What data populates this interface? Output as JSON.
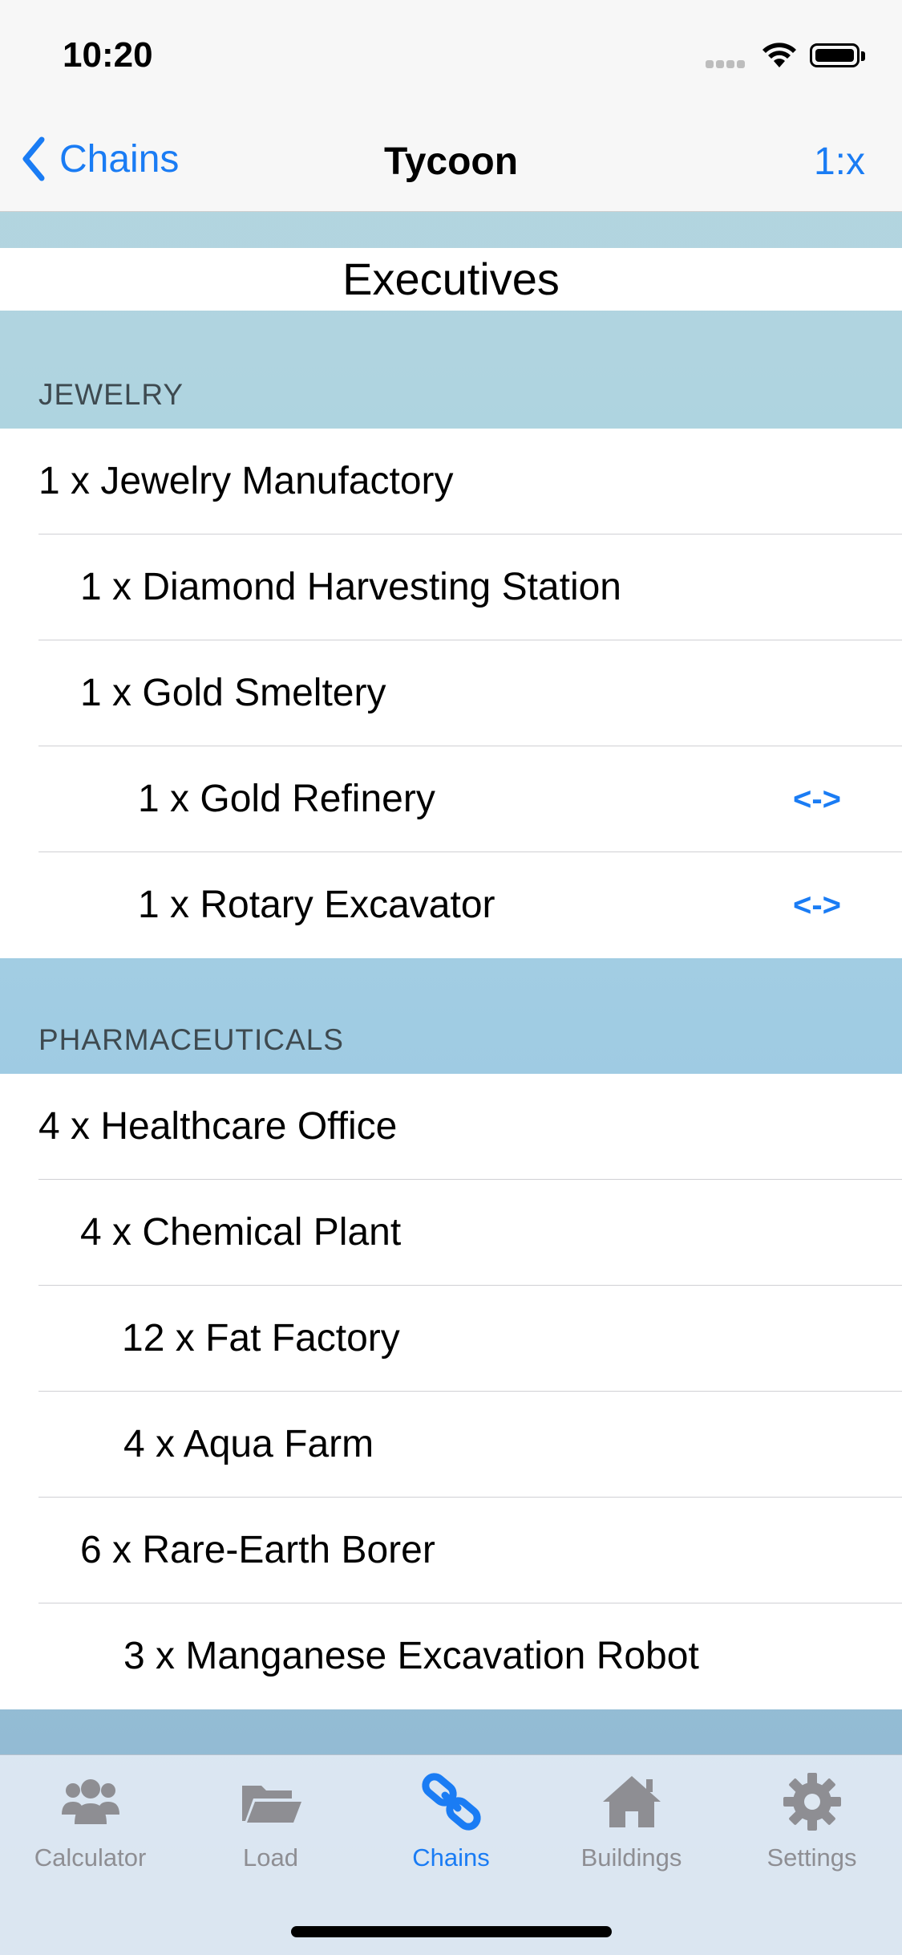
{
  "status": {
    "time": "10:20"
  },
  "nav": {
    "back_label": "Chains",
    "title": "Tycoon",
    "right_label": "1:x"
  },
  "header": {
    "title": "Executives"
  },
  "sections": [
    {
      "title": "JEWELRY",
      "rows": [
        {
          "text": "1 x Jewelry Manufactory",
          "level": 0
        },
        {
          "text": "1 x Diamond Harvesting Station",
          "level": 1
        },
        {
          "text": "1 x Gold Smeltery",
          "level": 1
        },
        {
          "text": "1 x Gold Refinery",
          "level": 2,
          "swap": "<->"
        },
        {
          "text": "1 x Rotary Excavator",
          "level": 2,
          "swap": "<->"
        }
      ]
    },
    {
      "title": "PHARMACEUTICALS",
      "rows": [
        {
          "text": "4 x Healthcare Office",
          "level": 0
        },
        {
          "text": "4 x Chemical Plant",
          "level": 1
        },
        {
          "text": "12 x Fat Factory",
          "level": 2
        },
        {
          "text": "4 x Aqua Farm",
          "level": 2
        },
        {
          "text": "6 x Rare-Earth Borer",
          "level": 1
        },
        {
          "text": "3 x Manganese Excavation Robot",
          "level": 2
        }
      ]
    }
  ],
  "tabs": [
    {
      "label": "Calculator",
      "icon": "people-icon",
      "active": false
    },
    {
      "label": "Load",
      "icon": "folder-icon",
      "active": false
    },
    {
      "label": "Chains",
      "icon": "chain-link-icon",
      "active": true
    },
    {
      "label": "Buildings",
      "icon": "house-icon",
      "active": false
    },
    {
      "label": "Settings",
      "icon": "gear-icon",
      "active": false
    }
  ],
  "colors": {
    "accent": "#1a7cf4",
    "inactive": "#8e8e93"
  }
}
